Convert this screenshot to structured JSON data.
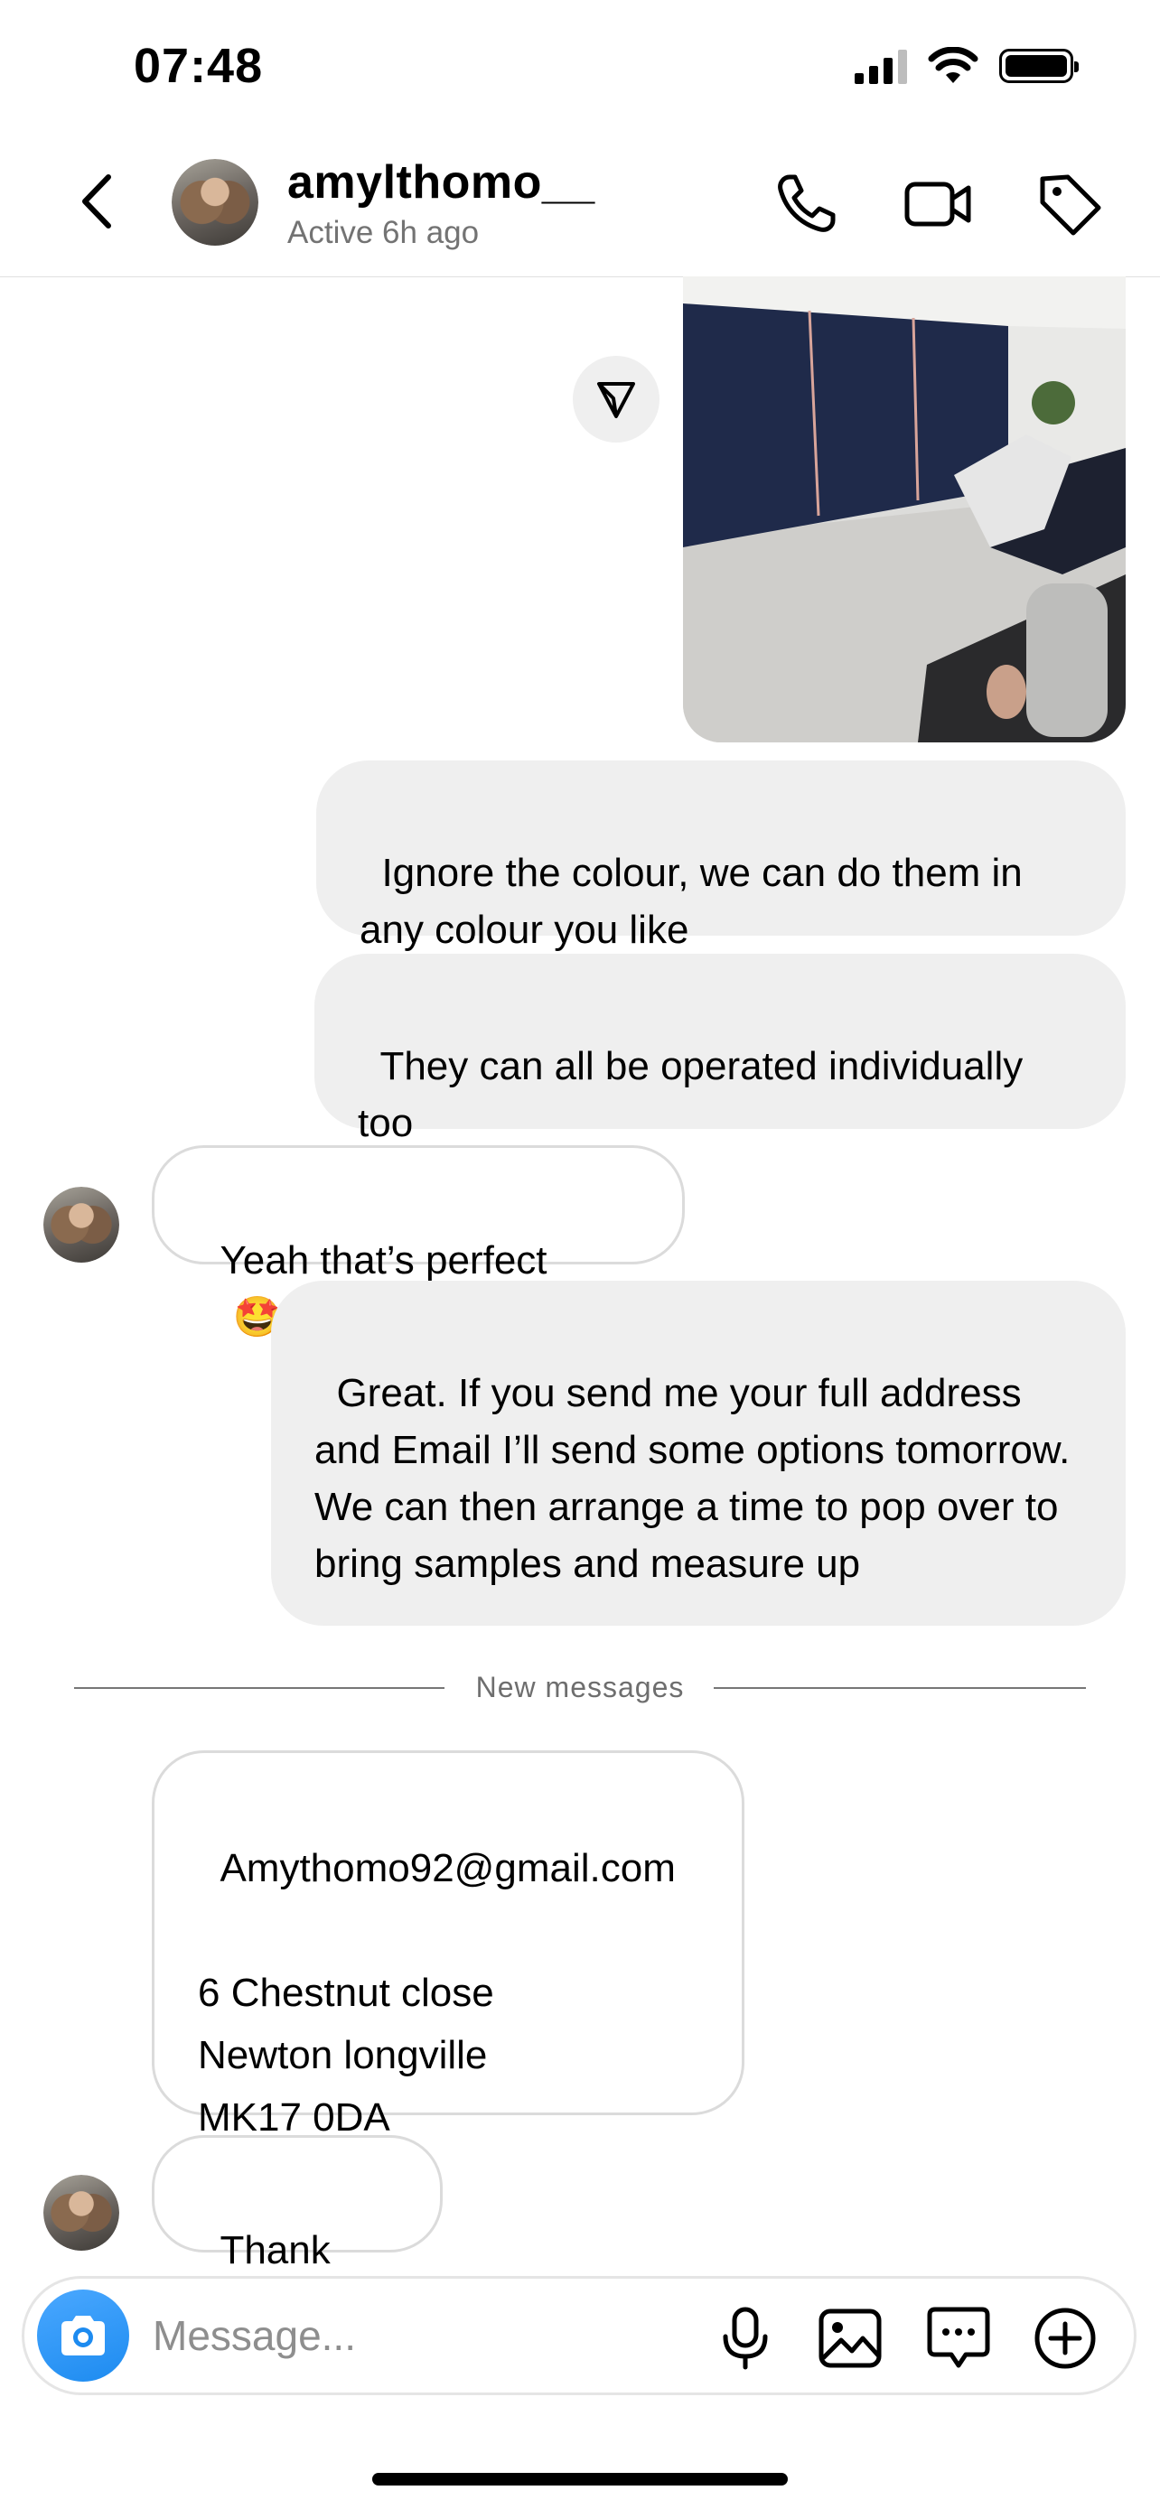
{
  "status_bar": {
    "time": "07:48"
  },
  "header": {
    "contact_name": "amylthomo__",
    "contact_status": "Active 6h ago"
  },
  "icons": {
    "back": "chevron-left-icon",
    "call": "phone-icon",
    "video": "video-camera-icon",
    "tag": "tag-icon",
    "share": "send-icon",
    "camera": "camera-icon",
    "mic": "microphone-icon",
    "gallery": "image-icon",
    "sticker": "chat-bubble-icon",
    "add": "plus-circle-icon"
  },
  "messages": [
    {
      "id": "m1",
      "direction": "outgoing",
      "text": "Ignore the colour, we can do them in any colour you like"
    },
    {
      "id": "m2",
      "direction": "outgoing",
      "text": "They can all be operated individually too"
    },
    {
      "id": "m3",
      "direction": "incoming",
      "text": "Yeah that’s perfect",
      "emoji": "🤩"
    },
    {
      "id": "m4",
      "direction": "outgoing",
      "text": "Great. If you send me your full address and Email I’ll send some options tomorrow. We can then arrange a time to pop over to bring samples and measure up"
    },
    {
      "id": "m5",
      "direction": "incoming",
      "text": "Amythomo92@gmail.com\n\n6 Chestnut close\nNewton longville\nMK17 0DA"
    },
    {
      "id": "m6",
      "direction": "incoming",
      "text": "Thank you"
    }
  ],
  "divider": {
    "label": "New messages"
  },
  "composer": {
    "placeholder": "Message..."
  },
  "colors": {
    "outgoing_bubble": "#efefef",
    "incoming_border": "#dbdbdb",
    "camera_button": "#1d8bf0",
    "secondary_text": "#737373"
  }
}
